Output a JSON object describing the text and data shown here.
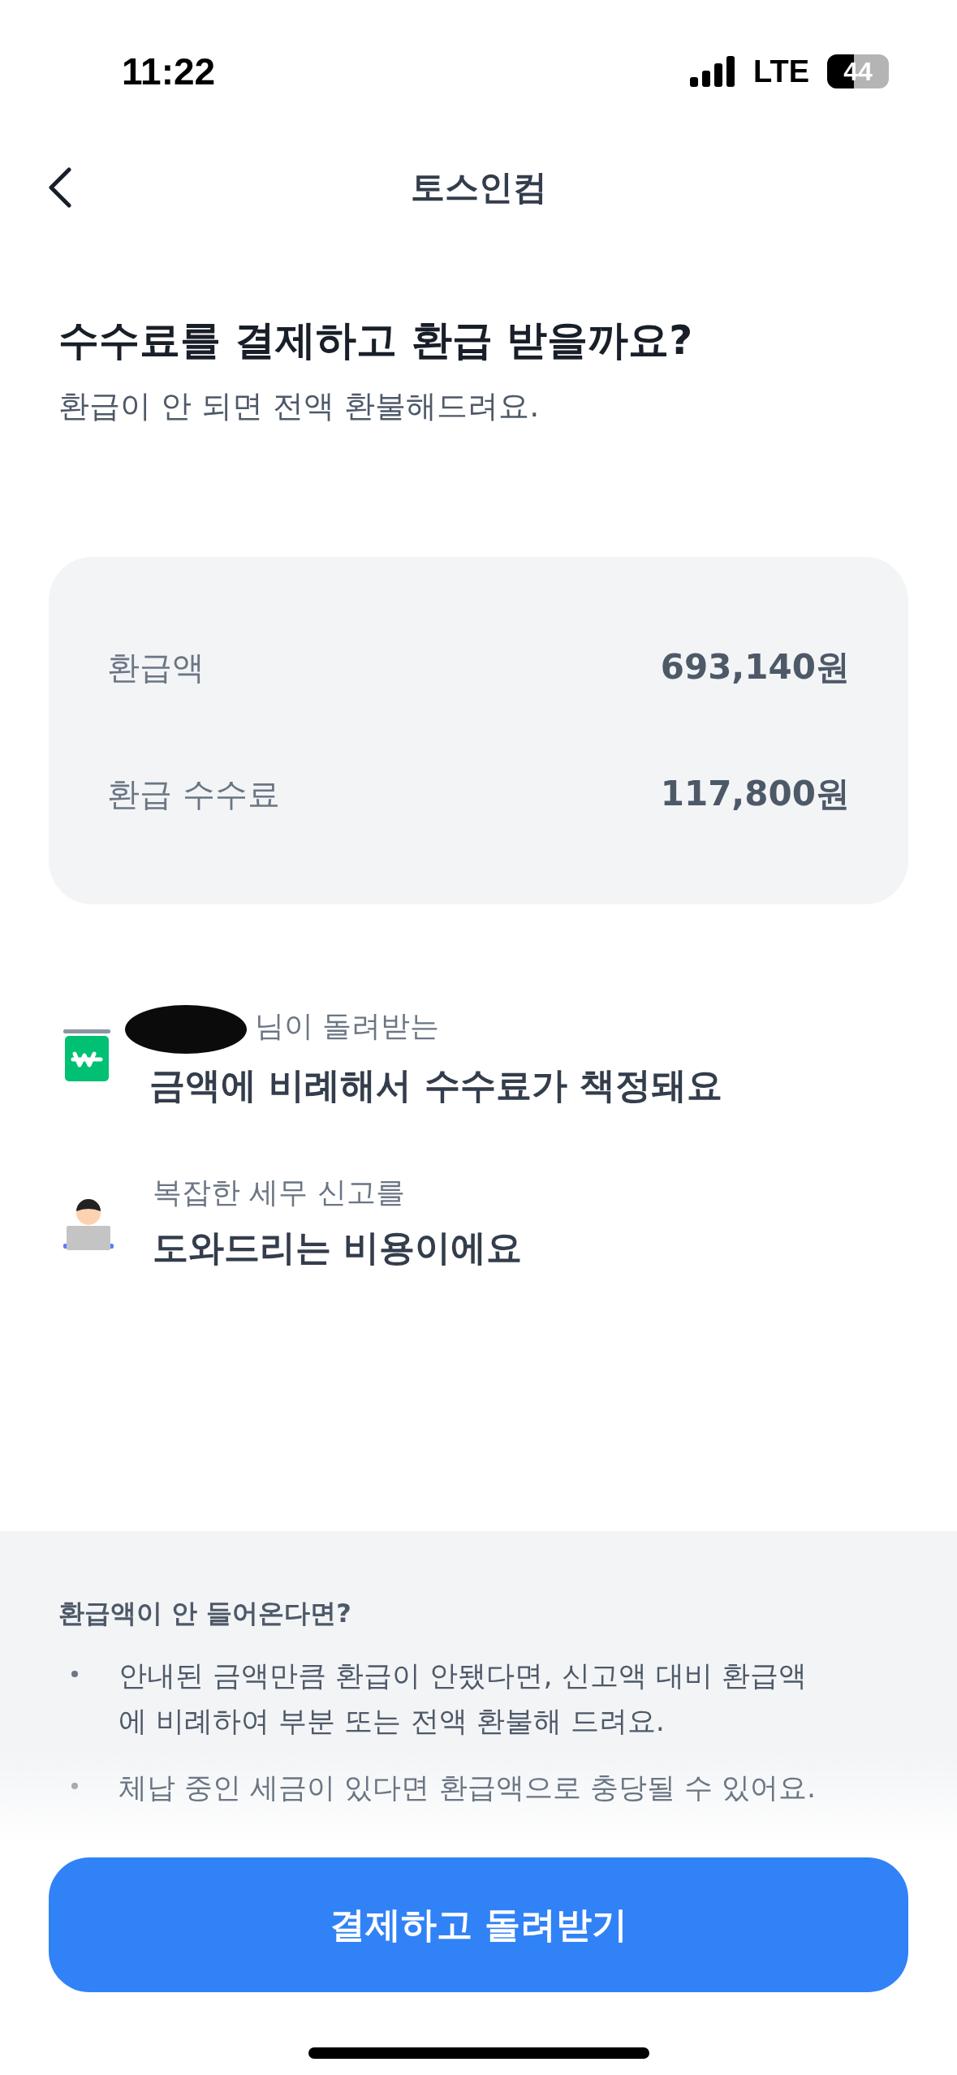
{
  "status_bar": {
    "time": "11:22",
    "network": "LTE",
    "battery": "44"
  },
  "nav": {
    "title": "토스인컴"
  },
  "heading": {
    "title": "수수료를 결제하고 환급 받을까요?",
    "subtitle": "환급이 안 되면 전액 환불해드려요."
  },
  "summary": [
    {
      "label": "환급액",
      "value": "693,140원"
    },
    {
      "label": "환급 수수료",
      "value": "117,800원"
    }
  ],
  "reasons": [
    {
      "kind": "money",
      "caption": "님이 돌려받는",
      "redacted": true,
      "text": "금액에 비례해서 수수료가 책정돼요"
    },
    {
      "kind": "person",
      "caption": "복잡한 세무 신고를",
      "redacted": false,
      "text": "도와드리는 비용이에요"
    }
  ],
  "notice": {
    "title": "환급액이 안 들어온다면?",
    "bullets": [
      "안내된 금액만큼 환급이 안됐다면, 신고액 대비 환급액에 비례하여 부분 또는 전액 환불해 드려요.",
      "체납 중인 세금이 있다면 환급액으로 충당될 수 있어요."
    ]
  },
  "button": {
    "label": "결제하고 돌려받기"
  }
}
